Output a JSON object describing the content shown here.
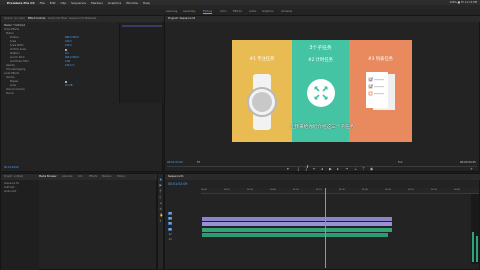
{
  "menu": {
    "apple": "",
    "app": "Premiere Pro CC",
    "items": [
      "File",
      "Edit",
      "Clip",
      "Sequence",
      "Markers",
      "Graphics",
      "Window",
      "Help"
    ],
    "status": "100% ■ Fri 11:13 PM"
  },
  "workspace_tabs": [
    "Learning",
    "Assembly",
    "Editing",
    "Color",
    "Effects",
    "Audio",
    "Graphics",
    "Libraries"
  ],
  "workspace_active": 2,
  "source_tabs": [
    "Source: (no clips)",
    "Effect Controls",
    "Audio Clip Mixer: Sequence 01",
    "Metadata"
  ],
  "effect_rows": [
    "Master * CLIP.mp4",
    "Video Effects",
    "Motion",
    "Position",
    "Scale",
    "Scale Width",
    "Uniform Scale",
    "Rotation",
    "Anchor Point",
    "Anti-flicker Filter",
    "Opacity",
    "Time Remapping",
    "Audio Effects",
    "Volume",
    "Bypass",
    "Level",
    "Channel Volume",
    "Panner"
  ],
  "effect_values": [
    "",
    "",
    "",
    "960.0 540.0",
    "100.0",
    "100.0",
    "",
    "0.0",
    "960.0 540.0",
    "0.00",
    "100.0 %",
    "",
    "",
    "",
    "",
    "0.0 dB",
    "",
    ""
  ],
  "program_tab": "Program: Sequence 01",
  "slide": {
    "title": "3个子任务",
    "task1": "#1 专注任务",
    "task2": "#2 计时任务",
    "task3": "#3 列表任务",
    "caption": "让我来给你们介绍这三个子任务"
  },
  "colors": {
    "left": "#e8bc53",
    "mid": "#44c4a3",
    "right": "#e88a5e",
    "accent": "#4da6ff"
  },
  "program_timecode": "00:01:02:09",
  "program_duration": "00:02:04:25",
  "fit": "Fit",
  "quality": "Full",
  "project_tabs": [
    "Project: untitled",
    "Media Browser",
    "Libraries",
    "Info",
    "Effects",
    "Markers",
    "History"
  ],
  "project_items": [
    "Sequence 01",
    "CLIP.mp4",
    "Audio.mp3"
  ],
  "timeline_tab": "Sequence 01",
  "timeline_timecode": "00:01:02:09",
  "ruler_labels": [
    "00:00",
    "00:15",
    "00:30",
    "00:45",
    "01:00",
    "01:15",
    "01:30",
    "01:45",
    "02:00",
    "02:15",
    "02:30",
    "02:45"
  ],
  "tracks": [
    "V3",
    "V2",
    "V1",
    "A1",
    "A2",
    "A3"
  ]
}
